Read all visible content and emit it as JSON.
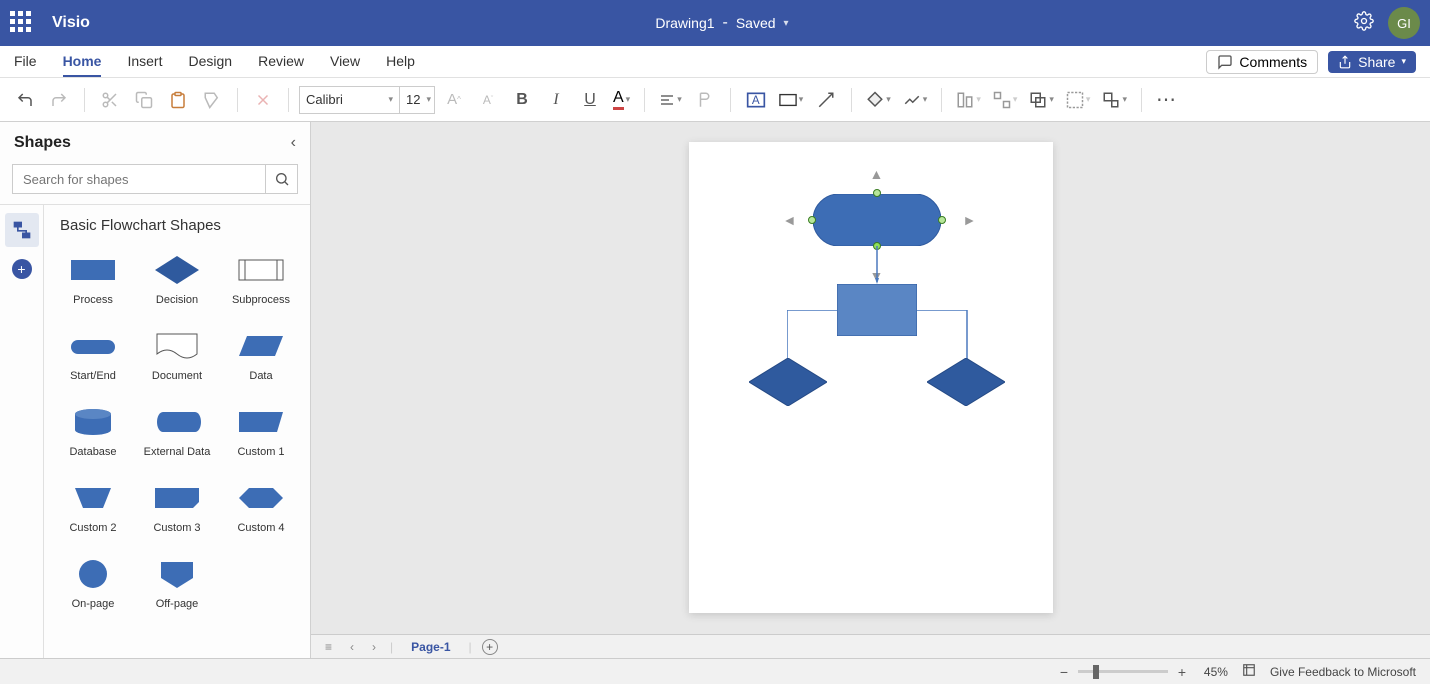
{
  "header": {
    "appName": "Visio",
    "docName": "Drawing1",
    "separator": "-",
    "saveStatus": "Saved",
    "userInitials": "GI"
  },
  "menu": {
    "tabs": [
      "File",
      "Home",
      "Insert",
      "Design",
      "Review",
      "View",
      "Help"
    ],
    "activeIndex": 1,
    "commentsLabel": "Comments",
    "shareLabel": "Share"
  },
  "ribbon": {
    "fontName": "Calibri",
    "fontSize": "12"
  },
  "shapesPanel": {
    "title": "Shapes",
    "searchPlaceholder": "Search for shapes",
    "stencilTitle": "Basic Flowchart Shapes",
    "shapes": [
      {
        "label": "Process",
        "icon": "process"
      },
      {
        "label": "Decision",
        "icon": "decision"
      },
      {
        "label": "Subprocess",
        "icon": "subprocess"
      },
      {
        "label": "Start/End",
        "icon": "startend"
      },
      {
        "label": "Document",
        "icon": "document"
      },
      {
        "label": "Data",
        "icon": "data"
      },
      {
        "label": "Database",
        "icon": "database"
      },
      {
        "label": "External Data",
        "icon": "extdata"
      },
      {
        "label": "Custom 1",
        "icon": "custom1"
      },
      {
        "label": "Custom 2",
        "icon": "custom2"
      },
      {
        "label": "Custom 3",
        "icon": "custom3"
      },
      {
        "label": "Custom 4",
        "icon": "custom4"
      },
      {
        "label": "On-page",
        "icon": "onpage"
      },
      {
        "label": "Off-page",
        "icon": "offpage"
      }
    ]
  },
  "canvas": {
    "pageTab": "Page-1"
  },
  "status": {
    "zoomPercent": "45%",
    "feedbackText": "Give Feedback to Microsoft"
  },
  "colors": {
    "brand": "#3955A3",
    "shapeFill": "#3d6db5",
    "shapeFillDark": "#2f5a9e"
  }
}
